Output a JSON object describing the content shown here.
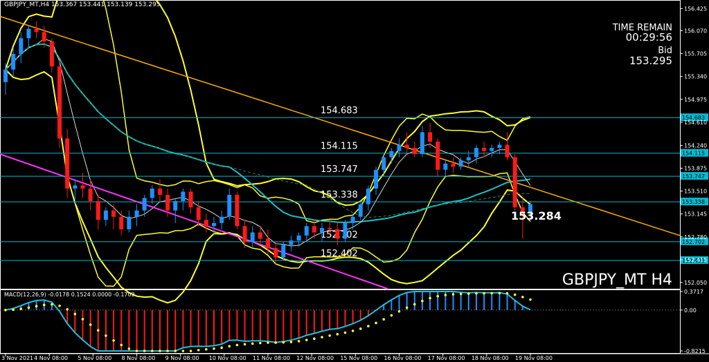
{
  "header": {
    "symbol_tf": "GBPJPY_MT,H4",
    "ohlc": "153.367 153.441 153.139 153.295"
  },
  "info": {
    "time_label": "TIME REMAIN",
    "time_value": "00:29:56",
    "bid_label": "Bid",
    "bid_value": "153.295"
  },
  "watermark": "GBPJPY_MT H4",
  "current_price_label": "153.284",
  "macd_label": "MACD(12,26,9) -0.0178 0.1524 0.0000 -0.1702",
  "colors": {
    "bull": "#1e90ff",
    "bear": "#ff1a1a",
    "bollinger": "#ffff33",
    "sma_cyan": "#20c0c8",
    "level_line": "#00bcd4",
    "trend_orange": "#ffb000",
    "trend_magenta": "#ff33ff",
    "price_axis": "#ffffff"
  },
  "chart_data": {
    "type": "candlestick",
    "symbol": "GBPJPY_MT",
    "timeframe": "H4",
    "y_ticks": [
      "156.425",
      "156.070",
      "155.705",
      "155.340",
      "154.975",
      "154.610",
      "154.240",
      "153.875",
      "153.510",
      "153.145",
      "152.780",
      "152.415",
      "152.050"
    ],
    "y_range": [
      151.95,
      156.55
    ],
    "x_ticks": [
      "3 Nov 2021",
      "4 Nov 08:00",
      "5 Nov 08:00",
      "8 Nov 08:00",
      "9 Nov 08:00",
      "10 Nov 08:00",
      "11 Nov 08:00",
      "12 Nov 08:00",
      "15 Nov 08:00",
      "16 Nov 08:00",
      "17 Nov 08:00",
      "18 Nov 08:00",
      "19 Nov 08:00"
    ],
    "levels": [
      {
        "label": "154.683",
        "value": 154.683
      },
      {
        "label": "154.115",
        "value": 154.115
      },
      {
        "label": "153.747",
        "value": 153.747
      },
      {
        "label": "153.338",
        "value": 153.338
      },
      {
        "label": "152.702",
        "value": 152.702
      },
      {
        "label": "152.402",
        "value": 152.402
      }
    ],
    "candles": [
      [
        155.25,
        155.55,
        155.05,
        155.45
      ],
      [
        155.45,
        155.8,
        155.35,
        155.7
      ],
      [
        155.7,
        156.05,
        155.55,
        155.95
      ],
      [
        155.95,
        156.15,
        155.8,
        156.1
      ],
      [
        156.1,
        156.22,
        155.95,
        156.05
      ],
      [
        156.05,
        156.15,
        155.8,
        155.9
      ],
      [
        155.9,
        155.95,
        155.4,
        155.5
      ],
      [
        155.5,
        155.6,
        154.2,
        154.35
      ],
      [
        154.35,
        154.5,
        153.4,
        153.55
      ],
      [
        153.55,
        153.7,
        153.3,
        153.6
      ],
      [
        153.6,
        153.8,
        153.4,
        153.55
      ],
      [
        153.55,
        153.7,
        153.2,
        153.35
      ],
      [
        153.35,
        153.45,
        152.9,
        153.05
      ],
      [
        153.05,
        153.25,
        152.95,
        153.2
      ],
      [
        153.2,
        153.3,
        152.9,
        153.1
      ],
      [
        153.1,
        153.2,
        152.8,
        152.9
      ],
      [
        152.9,
        153.2,
        152.85,
        153.1
      ],
      [
        153.1,
        153.3,
        152.95,
        153.2
      ],
      [
        153.2,
        153.45,
        153.1,
        153.4
      ],
      [
        153.4,
        153.6,
        153.3,
        153.55
      ],
      [
        153.55,
        153.7,
        153.35,
        153.45
      ],
      [
        153.45,
        153.55,
        153.1,
        153.2
      ],
      [
        153.2,
        153.4,
        153.0,
        153.35
      ],
      [
        153.35,
        153.55,
        153.2,
        153.5
      ],
      [
        153.5,
        153.55,
        153.15,
        153.25
      ],
      [
        153.25,
        153.35,
        152.95,
        153.05
      ],
      [
        153.05,
        153.15,
        152.85,
        152.95
      ],
      [
        152.95,
        153.1,
        152.8,
        153.0
      ],
      [
        153.0,
        153.2,
        152.9,
        153.1
      ],
      [
        153.1,
        153.55,
        153.05,
        153.45
      ],
      [
        153.45,
        153.5,
        152.9,
        152.95
      ],
      [
        152.95,
        153.05,
        152.6,
        152.7
      ],
      [
        152.7,
        152.95,
        152.6,
        152.85
      ],
      [
        152.85,
        152.95,
        152.65,
        152.75
      ],
      [
        152.75,
        152.9,
        152.5,
        152.6
      ],
      [
        152.6,
        152.7,
        152.35,
        152.45
      ],
      [
        152.45,
        152.7,
        152.4,
        152.65
      ],
      [
        152.65,
        152.8,
        152.55,
        152.72
      ],
      [
        152.72,
        152.85,
        152.62,
        152.8
      ],
      [
        152.8,
        153.0,
        152.7,
        152.95
      ],
      [
        152.95,
        153.05,
        152.75,
        152.85
      ],
      [
        152.85,
        153.0,
        152.7,
        152.92
      ],
      [
        152.92,
        153.05,
        152.8,
        152.9
      ],
      [
        152.9,
        153.0,
        152.65,
        152.75
      ],
      [
        152.75,
        153.05,
        152.7,
        153.0
      ],
      [
        153.0,
        153.15,
        152.9,
        153.1
      ],
      [
        153.1,
        153.35,
        153.05,
        153.3
      ],
      [
        153.3,
        153.6,
        153.2,
        153.55
      ],
      [
        153.55,
        153.9,
        153.45,
        153.85
      ],
      [
        153.85,
        154.1,
        153.75,
        154.05
      ],
      [
        154.05,
        154.2,
        153.95,
        154.15
      ],
      [
        154.15,
        154.35,
        154.05,
        154.25
      ],
      [
        154.25,
        154.45,
        154.1,
        154.2
      ],
      [
        154.2,
        154.3,
        154.05,
        154.1
      ],
      [
        154.1,
        154.55,
        154.05,
        154.45
      ],
      [
        154.45,
        154.6,
        154.2,
        154.3
      ],
      [
        154.3,
        154.35,
        153.75,
        153.85
      ],
      [
        153.85,
        154.0,
        153.75,
        153.95
      ],
      [
        153.95,
        154.05,
        153.8,
        153.9
      ],
      [
        153.9,
        154.05,
        153.85,
        154.0
      ],
      [
        154.0,
        154.15,
        153.9,
        154.05
      ],
      [
        154.05,
        154.25,
        153.95,
        154.2
      ],
      [
        154.2,
        154.3,
        154.05,
        154.15
      ],
      [
        154.15,
        154.25,
        154.05,
        154.2
      ],
      [
        154.2,
        154.3,
        154.1,
        154.25
      ],
      [
        154.25,
        154.45,
        154.0,
        154.05
      ],
      [
        154.05,
        154.1,
        153.2,
        153.25
      ],
      [
        153.25,
        153.4,
        152.75,
        153.15
      ],
      [
        153.15,
        153.35,
        153.05,
        153.3
      ]
    ],
    "annotations": [
      "154.683",
      "154.115",
      "153.747",
      "153.338",
      "152.702",
      "152.402"
    ],
    "macd": {
      "ticks": [
        "0.3717",
        "0.00",
        "-0.8215"
      ],
      "range": [
        -0.8215,
        0.3717
      ]
    }
  }
}
